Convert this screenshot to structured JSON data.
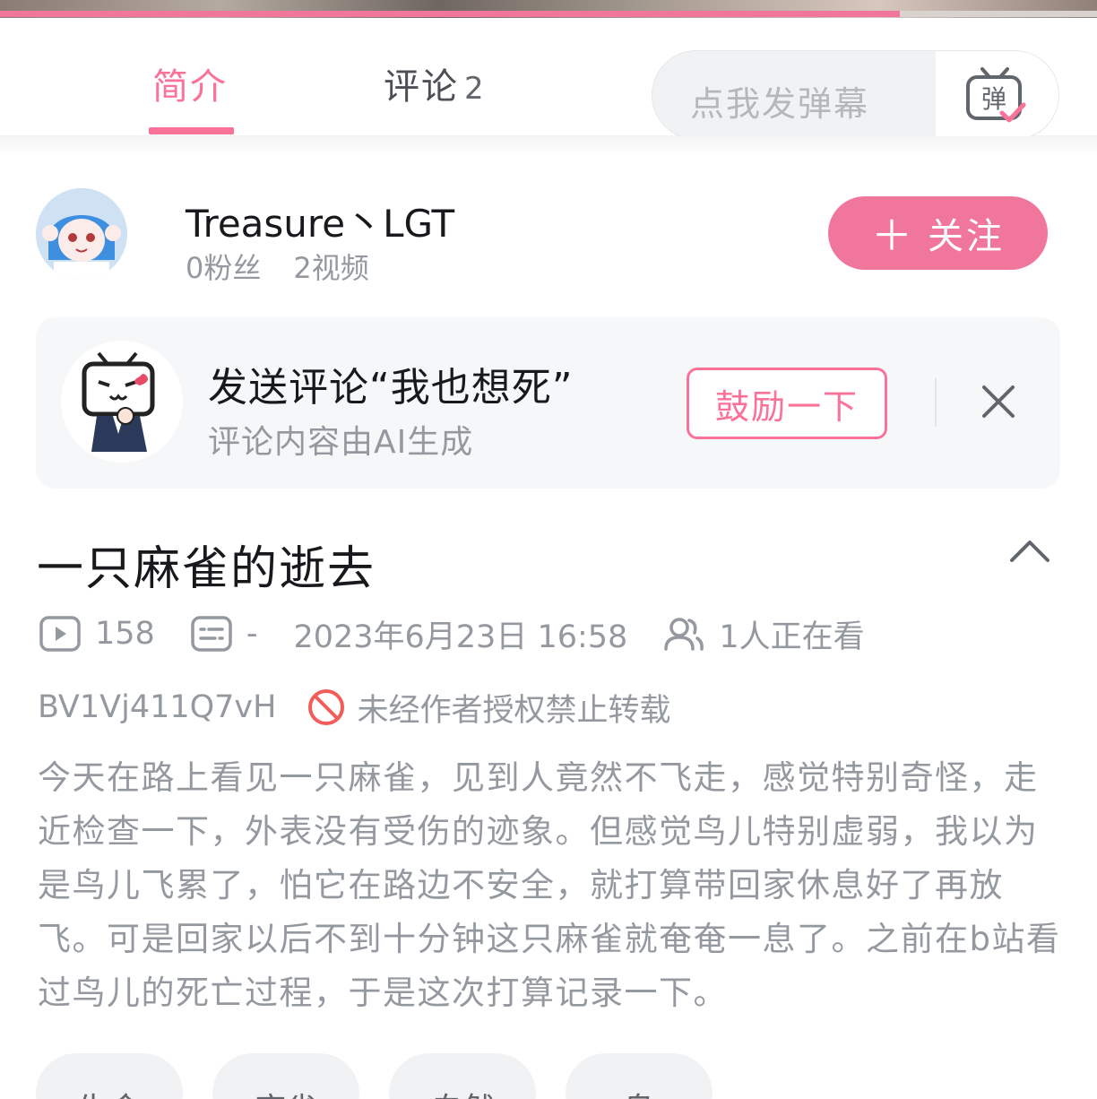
{
  "playback": {
    "progress_fraction": 0.82
  },
  "tabs": [
    {
      "label": "简介",
      "active": true
    },
    {
      "label": "评论",
      "count": "2"
    }
  ],
  "danmaku": {
    "placeholder": "点我发弹幕",
    "button_icon": "danmaku-toggle-icon"
  },
  "uploader": {
    "name": "Treasure丶LGT",
    "fans": "0粉丝",
    "videos": "2视频",
    "follow_label": "关注",
    "follow_icon": "plus-icon"
  },
  "ai_comment": {
    "title": "发送评论“我也想死”",
    "subtitle": "评论内容由AI生成",
    "encourage_label": "鼓励一下",
    "close_icon": "close-icon"
  },
  "video": {
    "title": "一只麻雀的逝去",
    "plays": "158",
    "danmaku_count": "-",
    "publish_time": "2023年6月23日 16:58",
    "watching": "1人正在看",
    "bvid": "BV1Vj411Q7vH",
    "copyright": "未经作者授权禁止转载",
    "description": "今天在路上看见一只麻雀，见到人竟然不飞走，感觉特别奇怪，走近检查一下，外表没有受伤的迹象。但感觉鸟儿特别虚弱，我以为是鸟儿飞累了，怕它在路边不安全，就打算带回家休息好了再放飞。可是回家以后不到十分钟这只麻雀就奄奄一息了。之前在b站看过鸟儿的死亡过程，于是这次打算记录一下。",
    "tags": [
      "生命",
      "麻雀",
      "自然",
      "鸟"
    ]
  },
  "colors": {
    "accent": "#fb7299",
    "text_secondary": "#9499a0",
    "card_bg": "#f6f7f8"
  }
}
